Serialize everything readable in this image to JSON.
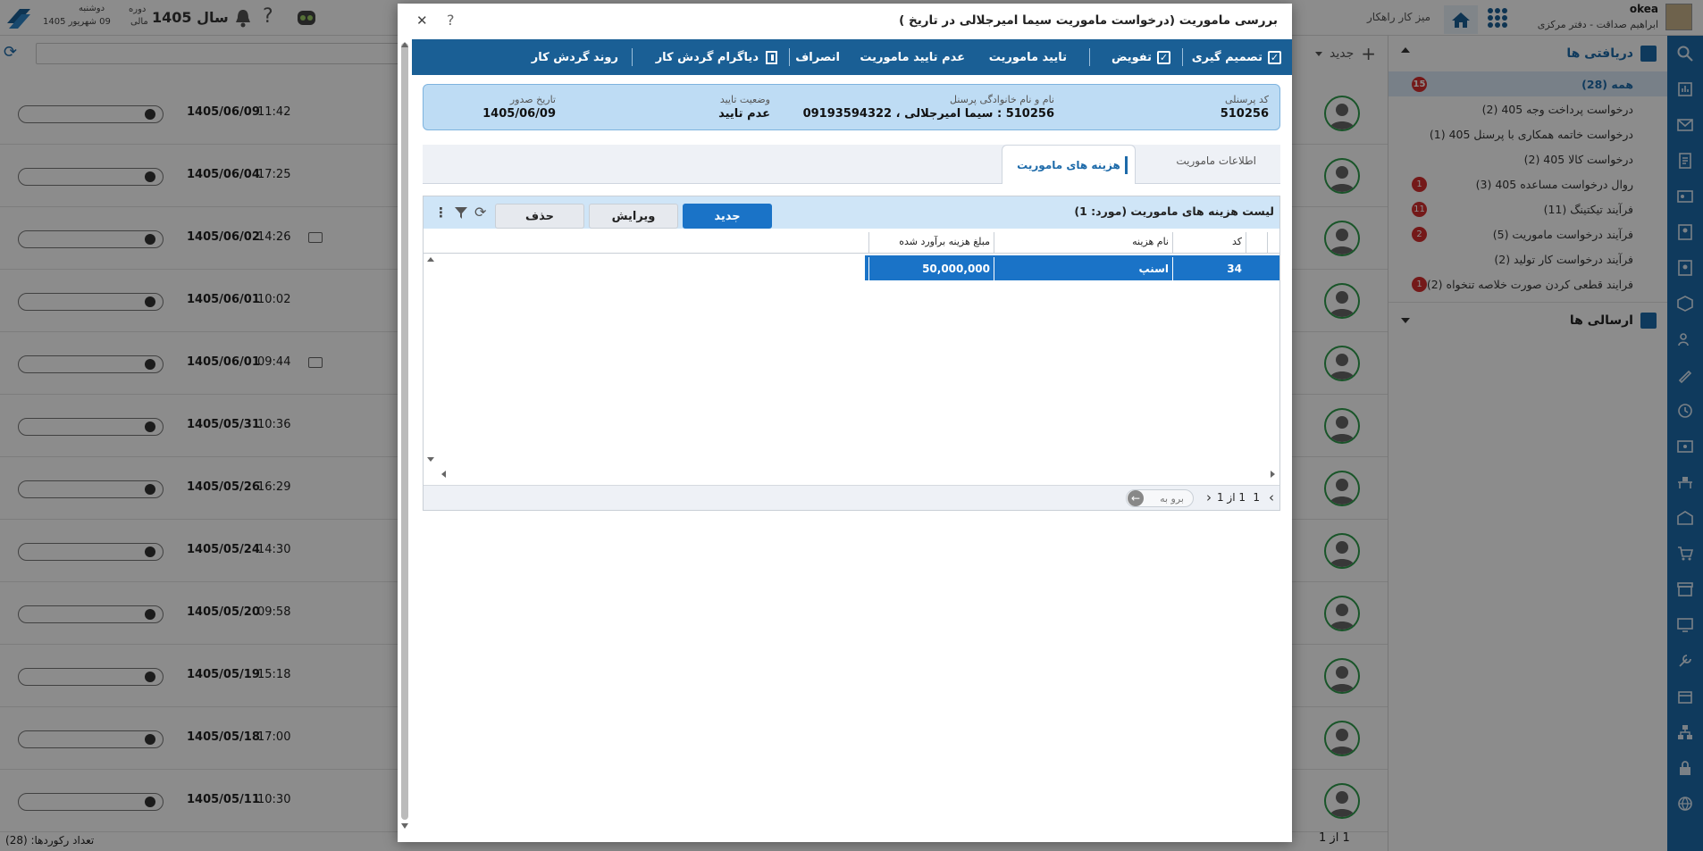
{
  "topbar": {
    "user_name": "okea",
    "user_role": "ابراهیم صداقت - دفتر مرکزی",
    "workdesk": "میز کار راهکار",
    "year_label": "سال 1405",
    "period_label": "دوره",
    "period_value": "مالی",
    "weekday": "دوشنبه",
    "date": "09 شهریور 1405",
    "new_label": "جدید"
  },
  "sidebar": {
    "received_label": "دریافتی ها",
    "sent_label": "ارسالی ها",
    "items": [
      {
        "label": "همه (28)",
        "badge": "15"
      },
      {
        "label": "درخواست پرداخت وجه 405 (2)",
        "badge": ""
      },
      {
        "label": "درخواست خاتمه همکاری با پرسنل 405 (1)",
        "badge": ""
      },
      {
        "label": "درخواست کالا 405 (2)",
        "badge": ""
      },
      {
        "label": "روال درخواست مساعده 405 (3)",
        "badge": "1"
      },
      {
        "label": "فرآیند تیکتینگ (11)",
        "badge": "11"
      },
      {
        "label": "فرآیند درخواست ماموریت (5)",
        "badge": "2"
      },
      {
        "label": "فرآیند درخواست کار تولید (2)",
        "badge": ""
      },
      {
        "label": "فرایند قطعی کردن صورت خلاصه تنخواه (2)",
        "badge": "1"
      }
    ]
  },
  "list": {
    "rows": [
      {
        "date": "1405/06/09",
        "time": "11:42",
        "comment": false
      },
      {
        "date": "1405/06/04",
        "time": "17:25",
        "comment": false
      },
      {
        "date": "1405/06/02",
        "time": "14:26",
        "comment": true
      },
      {
        "date": "1405/06/01",
        "time": "10:02",
        "comment": false
      },
      {
        "date": "1405/06/01",
        "time": "09:44",
        "comment": true
      },
      {
        "date": "1405/05/31",
        "time": "10:36",
        "comment": false
      },
      {
        "date": "1405/05/26",
        "time": "16:29",
        "comment": false
      },
      {
        "date": "1405/05/24",
        "time": "14:30",
        "comment": false
      },
      {
        "date": "1405/05/20",
        "time": "09:58",
        "comment": false
      },
      {
        "date": "1405/05/19",
        "time": "15:18",
        "comment": false
      },
      {
        "date": "1405/05/18",
        "time": "17:00",
        "comment": false
      },
      {
        "date": "1405/05/11",
        "time": "10:30",
        "comment": false
      }
    ],
    "record_count": "تعداد رکوردها: (28)",
    "pager": "1 از 1"
  },
  "modal": {
    "title": "بررسی ماموریت (درخواست ماموریت سیما امیرجلالی در تاریخ )",
    "help": "?",
    "close": "✕",
    "toolbar": {
      "decide": "تصمیم گیری",
      "delegate": "تفویض",
      "approve": "تایید ماموریت",
      "reject": "عدم تایید ماموریت",
      "cancel": "انصراف",
      "diagram": "دیاگرام گردش کار",
      "process": "روند گردش کار"
    },
    "info": {
      "code_label": "کد پرسنلی",
      "code_value": "510256",
      "name_label": "نام و نام خانوادگی پرسنل",
      "name_value": "510256 : سیما امیرجلالی ، 09193594322",
      "status_label": "وضعیت تایید",
      "status_value": "عدم تایید",
      "date_label": "تاریخ صدور",
      "date_value": "1405/06/09"
    },
    "tabs": {
      "expenses": "هزینه های ماموریت",
      "info": "اطلاعات ماموریت"
    },
    "grid": {
      "title": "لیست هزینه های ماموریت (مورد: 1)",
      "new": "جدید",
      "edit": "ویرایش",
      "delete": "حذف",
      "headers": {
        "code": "کد",
        "name": "نام هزینه",
        "amount": "مبلغ هزینه برآورد شده"
      },
      "rows": [
        {
          "code": "34",
          "name": "اسنپ",
          "amount": "50,000,000"
        }
      ],
      "pager": {
        "page": "1",
        "of": "1 از 1",
        "goto": "برو به"
      }
    }
  }
}
